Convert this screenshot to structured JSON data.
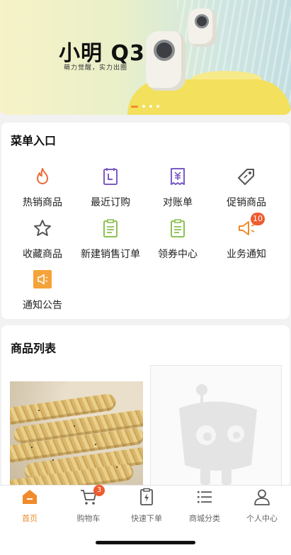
{
  "banner": {
    "title": "小明 Q3",
    "subtitle": "萌力觉醒，实力出圈",
    "slide_count": 4,
    "active_slide": 1
  },
  "menu": {
    "title": "菜单入口",
    "items": [
      {
        "label": "热销商品",
        "icon": "flame-icon",
        "color": "#ee6a35"
      },
      {
        "label": "最近订购",
        "icon": "calendar-icon",
        "color": "#7c5bc4"
      },
      {
        "label": "对账单",
        "icon": "receipt-icon",
        "color": "#7c5bc4"
      },
      {
        "label": "促销商品",
        "icon": "tag-icon",
        "color": "#555555"
      },
      {
        "label": "收藏商品",
        "icon": "star-icon",
        "color": "#555555"
      },
      {
        "label": "新建销售订单",
        "icon": "clipboard-icon",
        "color": "#8cc152"
      },
      {
        "label": "领券中心",
        "icon": "clipboard-icon",
        "color": "#8cc152"
      },
      {
        "label": "业务通知",
        "icon": "megaphone-icon",
        "color": "#f08a2c",
        "badge": "10"
      },
      {
        "label": "通知公告",
        "icon": "announcement-icon",
        "color": "#f4a23a"
      }
    ]
  },
  "goods": {
    "title": "商品列表"
  },
  "tabbar": {
    "tabs": [
      {
        "label": "首页",
        "icon": "home-icon",
        "active": true
      },
      {
        "label": "购物车",
        "icon": "cart-icon",
        "badge": "3"
      },
      {
        "label": "快速下单",
        "icon": "quick-order-icon"
      },
      {
        "label": "商城分类",
        "icon": "category-list-icon"
      },
      {
        "label": "个人中心",
        "icon": "user-icon"
      }
    ]
  },
  "colors": {
    "accent": "#f08a2c",
    "badge": "#ee5b2e"
  }
}
